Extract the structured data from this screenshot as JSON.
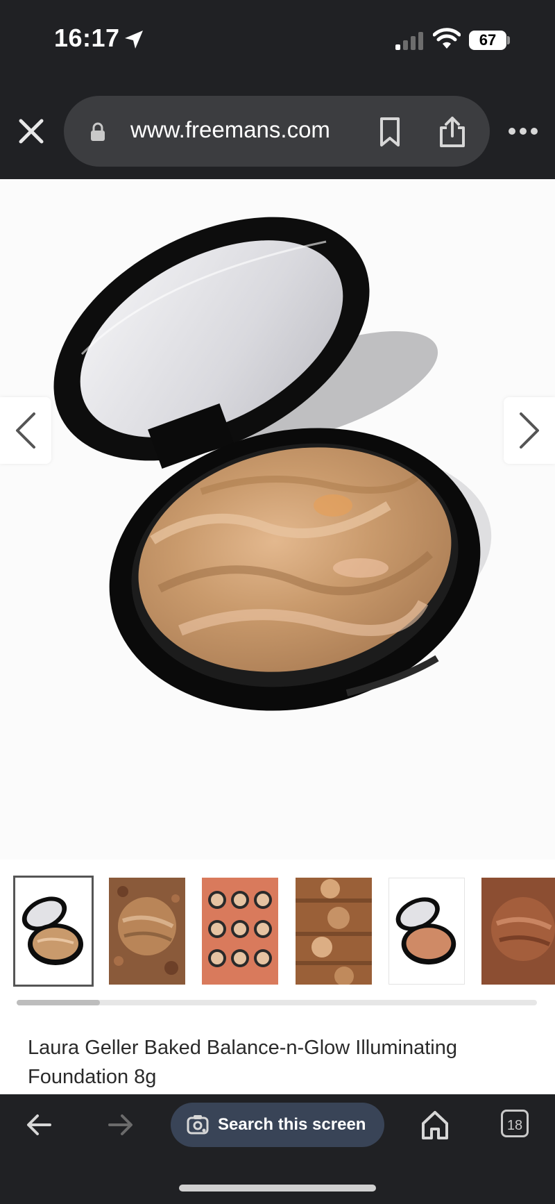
{
  "status_bar": {
    "time": "16:17",
    "battery": "67",
    "icons": [
      "location-arrow-icon",
      "signal-icon",
      "wifi-icon",
      "battery-icon"
    ]
  },
  "browser": {
    "url": "www.freemans.com",
    "icons": [
      "close-icon",
      "lock-icon",
      "bookmark-icon",
      "share-icon",
      "more-icon"
    ]
  },
  "gallery": {
    "thumbnail_count": 6,
    "selected_index": 0,
    "scroll_position": 0.15,
    "icons": [
      "chevron-left-icon",
      "chevron-right-icon"
    ]
  },
  "product": {
    "title": "Laura Geller Baked Balance-n-Glow Illuminating Foundation 8g"
  },
  "bottom_bar": {
    "search_label": "Search this screen",
    "tabs_count": "18",
    "icons": [
      "back-arrow-icon",
      "forward-arrow-icon",
      "lens-icon",
      "home-icon",
      "tabs-icon"
    ]
  },
  "colors": {
    "chrome": "#202124",
    "url_bar": "#3c3d40",
    "search_pill": "#394457",
    "powder": "#c89a6e",
    "compact": "#111111"
  }
}
